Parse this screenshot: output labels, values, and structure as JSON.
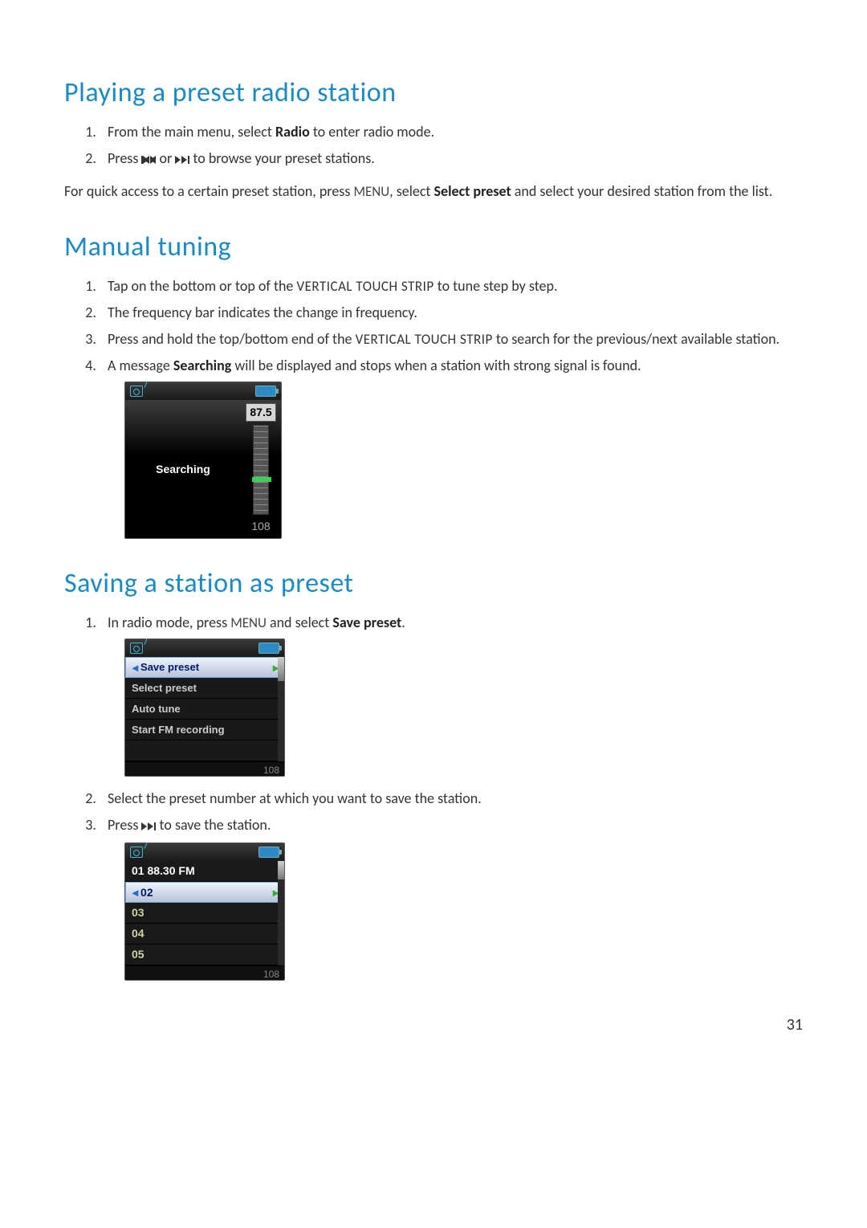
{
  "sections": {
    "playing": {
      "title": "Playing a preset radio station",
      "step1_a": "From the main menu, select ",
      "step1_bold": "Radio",
      "step1_b": " to enter radio mode.",
      "step2_a": "Press ",
      "step2_b": " or ",
      "step2_c": " to browse your preset stations.",
      "note_a": "For quick access to a certain preset station, press ",
      "note_menu": "MENU",
      "note_b": ", select ",
      "note_bold": "Select preset",
      "note_c": " and select your desired station from the list."
    },
    "manual": {
      "title": "Manual tuning",
      "step1_a": "Tap on the bottom or top of the ",
      "step1_caps": "VERTICAL TOUCH STRIP",
      "step1_b": " to tune step by step.",
      "step2": "The frequency bar indicates the change in frequency.",
      "step3_a": "Press and hold the top/bottom end of the ",
      "step3_caps": "VERTICAL TOUCH STRIP",
      "step3_b": " to search for the previous/next available station.",
      "step4_a": "A message ",
      "step4_bold": "Searching",
      "step4_b": " will be displayed and stops when a station with strong signal is found."
    },
    "saving": {
      "title": "Saving a station as preset",
      "step1_a": "In radio mode, press ",
      "step1_menu": "MENU",
      "step1_b": " and select ",
      "step1_bold": "Save preset",
      "step1_c": ".",
      "step2": "Select the preset number at which you want to save the station.",
      "step3_a": "Press ",
      "step3_b": " to save the station."
    }
  },
  "screens": {
    "searching": {
      "label": "Searching",
      "top_freq": "87.5",
      "bottom_freq": "108"
    },
    "menu": {
      "items": [
        "Save preset",
        "Select preset",
        "Auto tune",
        "Start FM recording"
      ],
      "footer": "108"
    },
    "presets": {
      "rows": [
        "01  88.30 FM",
        "02",
        "03",
        "04",
        "05"
      ],
      "selected_index": 1,
      "footer": "108"
    }
  },
  "page_number": "31"
}
